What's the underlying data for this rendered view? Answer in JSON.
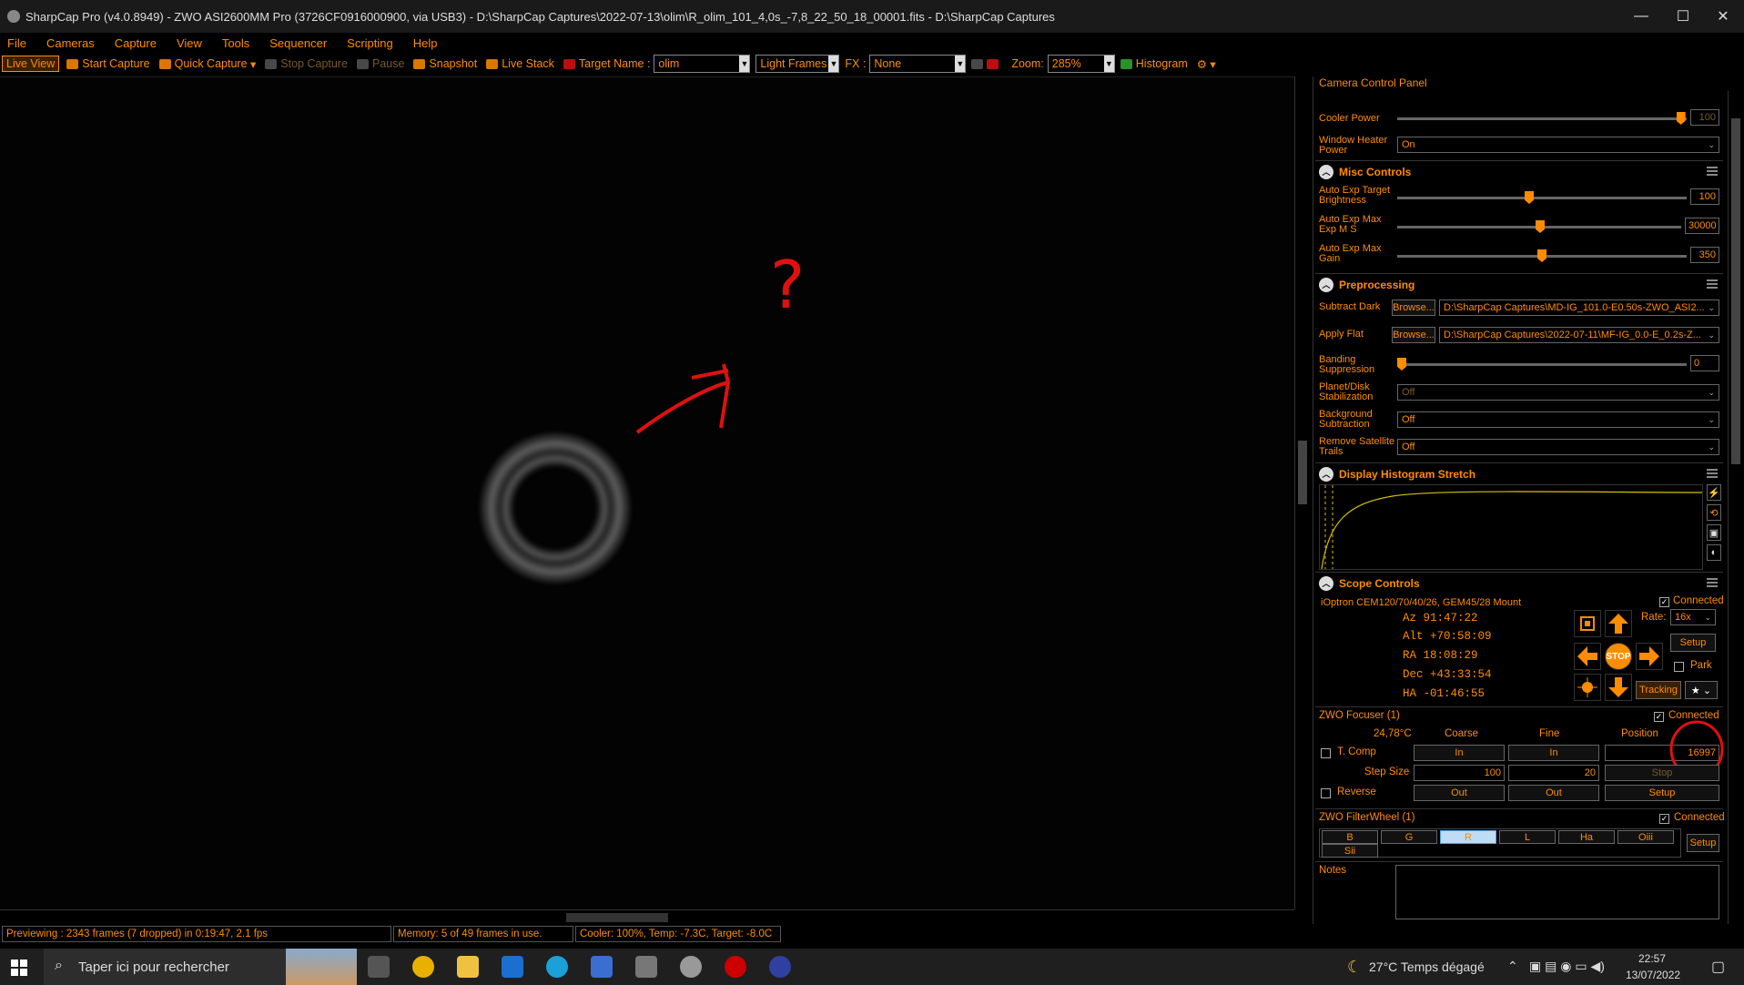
{
  "window": {
    "title": "SharpCap Pro (v4.0.8949) - ZWO ASI2600MM Pro (3726CF0916000900, via USB3) - D:\\SharpCap Captures\\2022-07-13\\olim\\R_olim_101_4,0s_-7,8_22_50_18_00001.fits - D:\\SharpCap Captures",
    "minimize": "—",
    "maximize": "☐",
    "close": "✕"
  },
  "menu": [
    "File",
    "Cameras",
    "Capture",
    "View",
    "Tools",
    "Sequencer",
    "Scripting",
    "Help"
  ],
  "toolbar": {
    "live_view": "Live View",
    "start_capture": "Start Capture",
    "quick_capture": "Quick Capture",
    "stop_capture": "Stop Capture",
    "pause": "Pause",
    "snapshot": "Snapshot",
    "live_stack": "Live Stack",
    "target_name_label": "Target Name :",
    "target_name_value": "olim",
    "frame_type": "Light Frames",
    "fx_label": "FX :",
    "fx_value": "None",
    "zoom_label": "Zoom:",
    "zoom_value": "285%",
    "histogram": "Histogram"
  },
  "annotations": {
    "question_mark": "?"
  },
  "status": {
    "previewing": "Previewing : 2343 frames (7 dropped) in 0:19:47, 2.1 fps",
    "memory": "Memory: 5 of 49 frames in use.",
    "cooler": "Cooler: 100%, Temp: -7.3C, Target: -8.0C"
  },
  "panel": {
    "title": "Camera Control Panel",
    "cooler_power_label": "Cooler Power",
    "cooler_power_value": "100",
    "cooler_power_fraction": 0.98,
    "window_heater_label": "Window Heater Power",
    "window_heater_value": "On",
    "misc": {
      "title": "Misc Controls",
      "auto_exp_target_label": "Auto Exp Target Brightness",
      "auto_exp_target_value": "100",
      "auto_exp_maxms_label": "Auto Exp Max Exp M S",
      "auto_exp_maxms_value": "30000",
      "auto_exp_maxgain_label": "Auto Exp Max Gain",
      "auto_exp_maxgain_value": "350"
    },
    "preprocessing": {
      "title": "Preprocessing",
      "subtract_dark_label": "Subtract Dark",
      "browse": "Browse...",
      "subtract_dark_value": "D:\\SharpCap Captures\\MD-IG_101.0-E0.50s-ZWO_ASI2...",
      "apply_flat_label": "Apply Flat",
      "apply_flat_value": "D:\\SharpCap Captures\\2022-07-11\\MF-IG_0.0-E_0.2s-Z...",
      "banding_label": "Banding Suppression",
      "banding_value": "0",
      "planet_label": "Planet/Disk Stabilization",
      "planet_value": "Off",
      "background_label": "Background Subtraction",
      "background_value": "Off",
      "satellite_label": "Remove Satellite Trails",
      "satellite_value": "Off"
    },
    "histogram_stretch": {
      "title": "Display Histogram Stretch"
    },
    "scope": {
      "title": "Scope Controls",
      "mount": "iOptron CEM120/70/40/26, GEM45/28 Mount",
      "connected": "Connected",
      "az": "Az    91:47:22",
      "alt": "Alt  +70:58:09",
      "ra": "RA    18:08:29",
      "dec": "Dec  +43:33:54",
      "ha": "HA   -01:46:55",
      "stop": "STOP",
      "rate_label": "Rate:",
      "rate_value": "16x",
      "setup": "Setup",
      "park": "Park",
      "tracking": "Tracking"
    },
    "focuser": {
      "title": "ZWO Focuser (1)",
      "connected": "Connected",
      "temp": "24,78°C",
      "coarse": "Coarse",
      "fine": "Fine",
      "position_label": "Position",
      "tcomp": "T. Comp",
      "in": "In",
      "position_value": "16997",
      "step_size_label": "Step Size",
      "coarse_step": "100",
      "fine_step": "20",
      "stop": "Stop",
      "reverse": "Reverse",
      "out": "Out",
      "setup": "Setup"
    },
    "filterwheel": {
      "title": "ZWO FilterWheel (1)",
      "connected": "Connected",
      "filters": [
        "B",
        "G",
        "R",
        "L",
        "Ha",
        "Oiii",
        "Sii"
      ],
      "selected": "R",
      "setup": "Setup"
    },
    "notes_label": "Notes"
  },
  "taskbar": {
    "search_placeholder": "Taper ici pour rechercher",
    "weather": "27°C  Temps dégagé",
    "time": "22:57",
    "date": "13/07/2022"
  }
}
